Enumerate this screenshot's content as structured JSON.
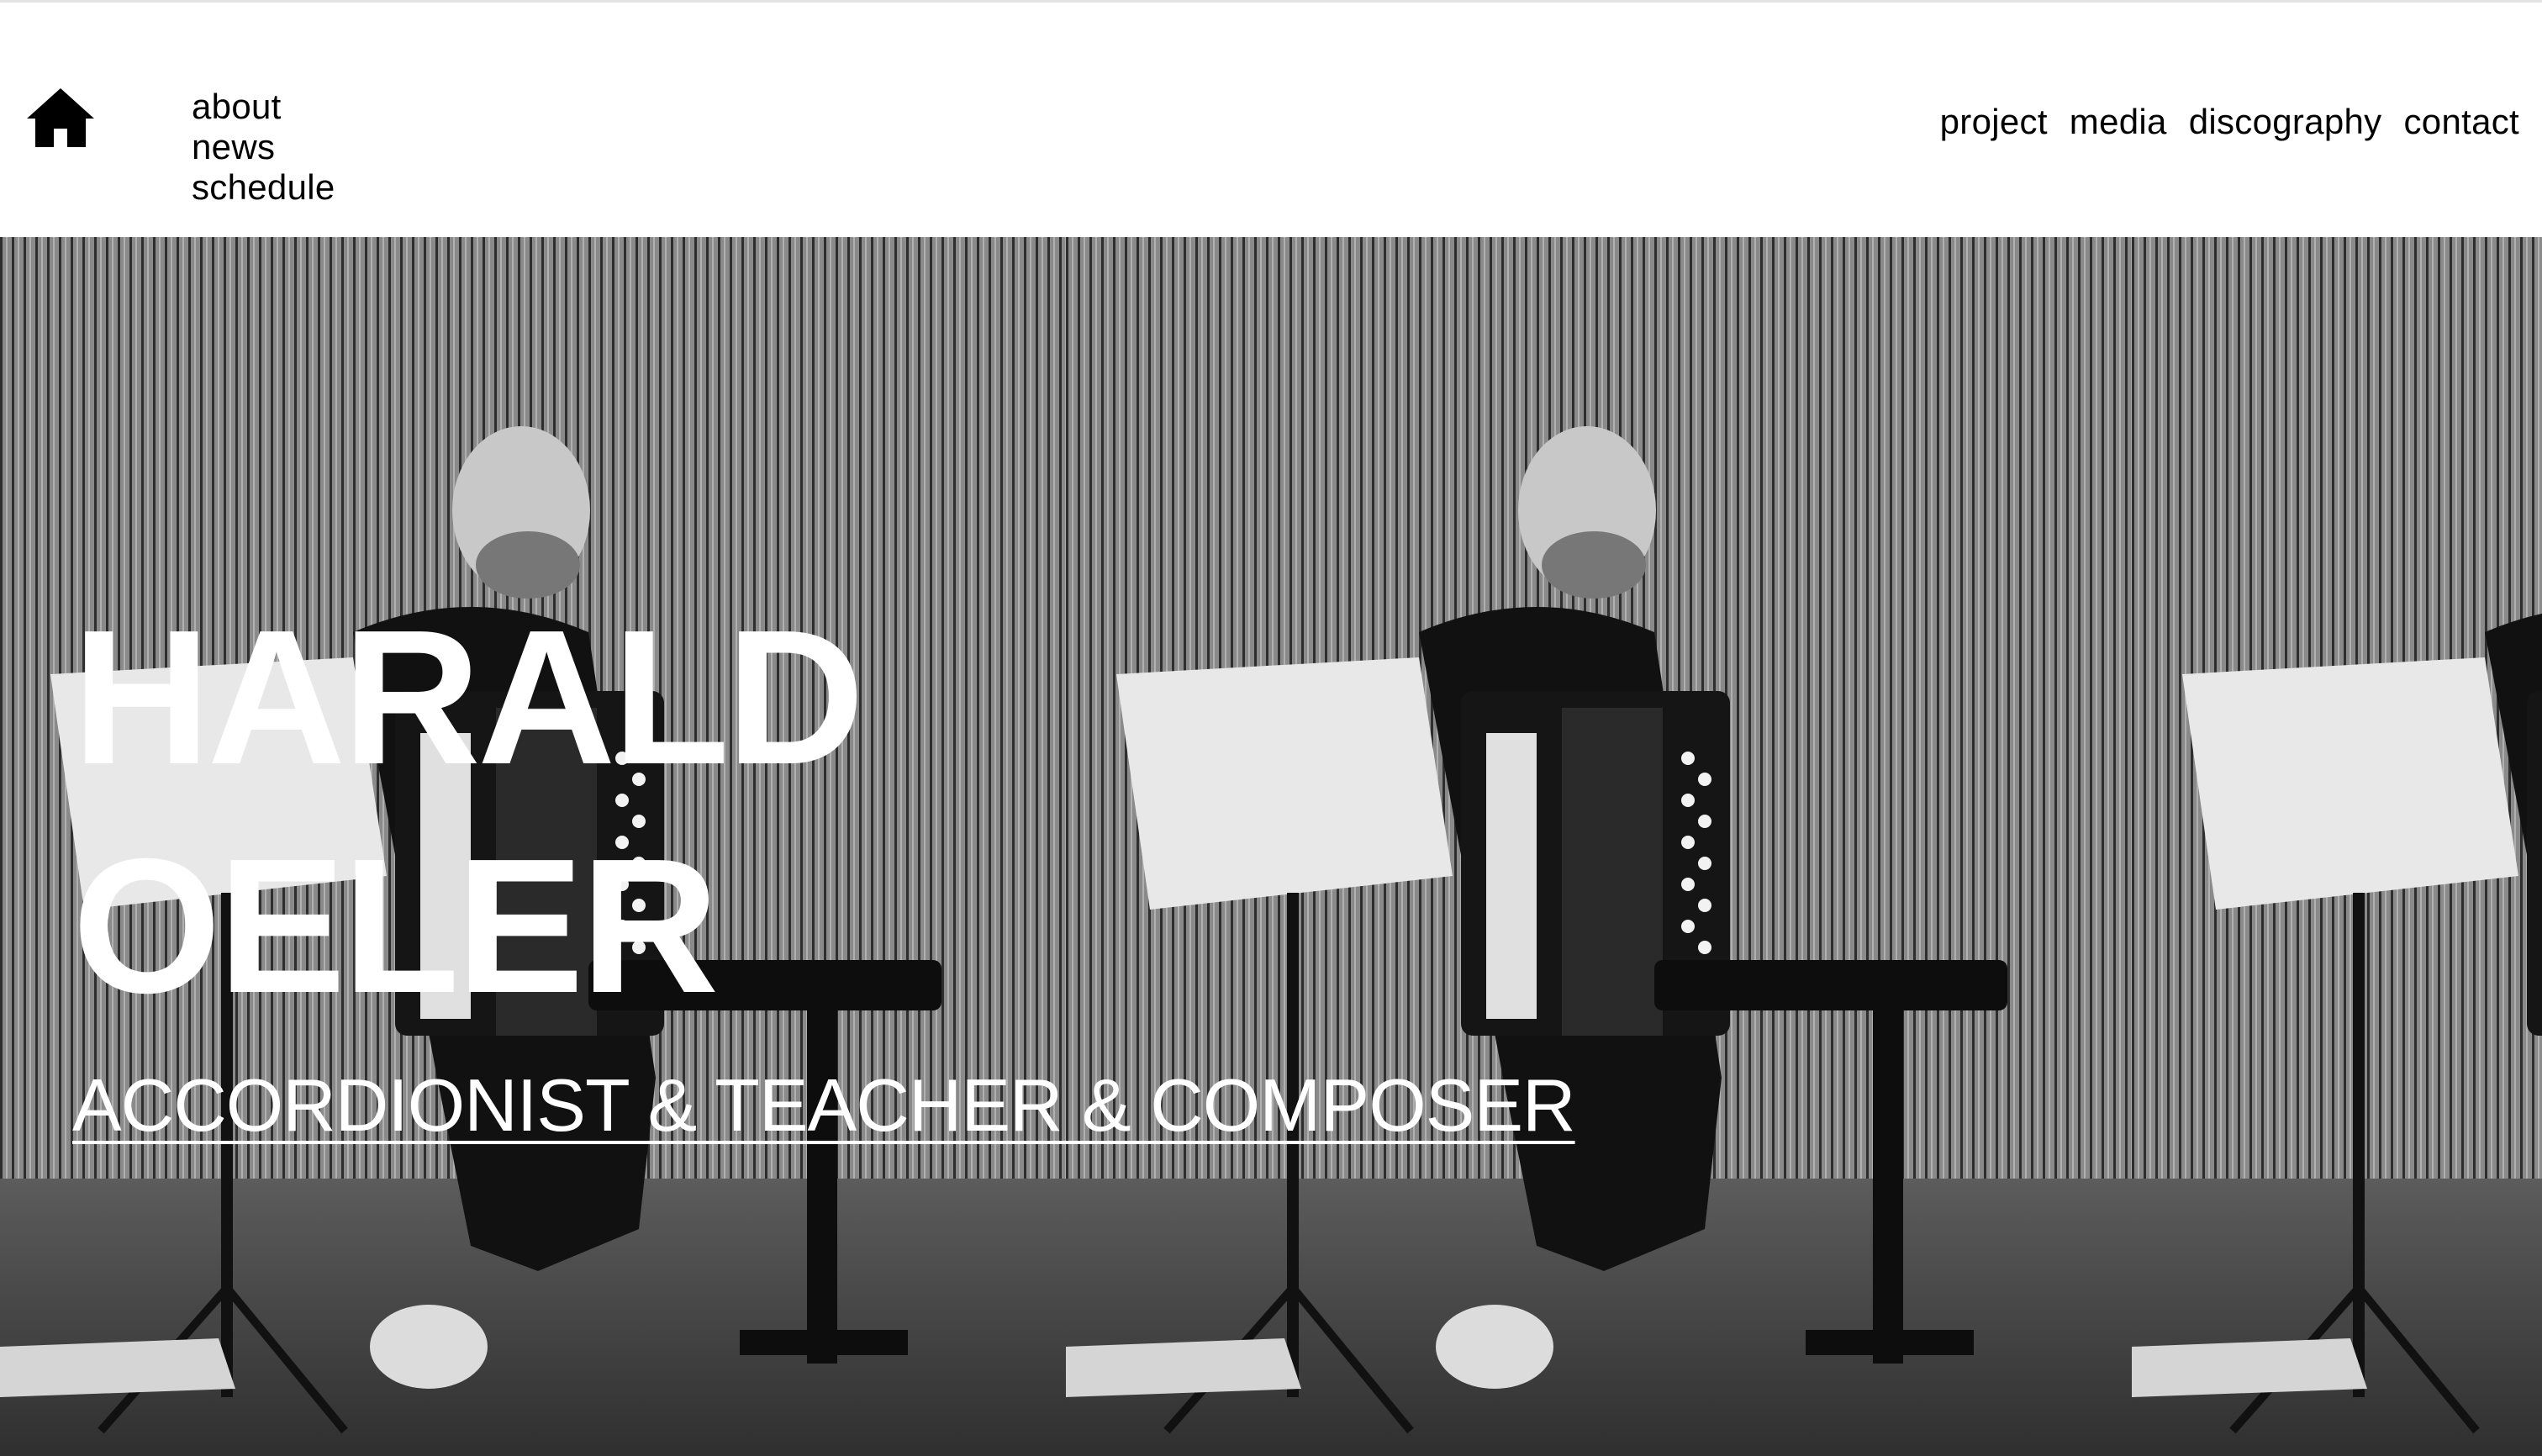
{
  "header": {
    "home_icon": "house-icon",
    "left_nav": [
      {
        "label": "about"
      },
      {
        "label": "news"
      },
      {
        "label": "schedule"
      }
    ],
    "right_nav": [
      {
        "label": "project"
      },
      {
        "label": "media"
      },
      {
        "label": "discography"
      },
      {
        "label": "contact"
      }
    ]
  },
  "hero": {
    "title": "HARALD\nOELER",
    "subtitle": "ACCORDIONIST & TEACHER & COMPOSER",
    "image": "black-and-white photo of accordionist seated with music stand, repeated three times"
  },
  "colors": {
    "text_dark": "#000000",
    "text_light": "#ffffff",
    "background": "#ffffff"
  }
}
